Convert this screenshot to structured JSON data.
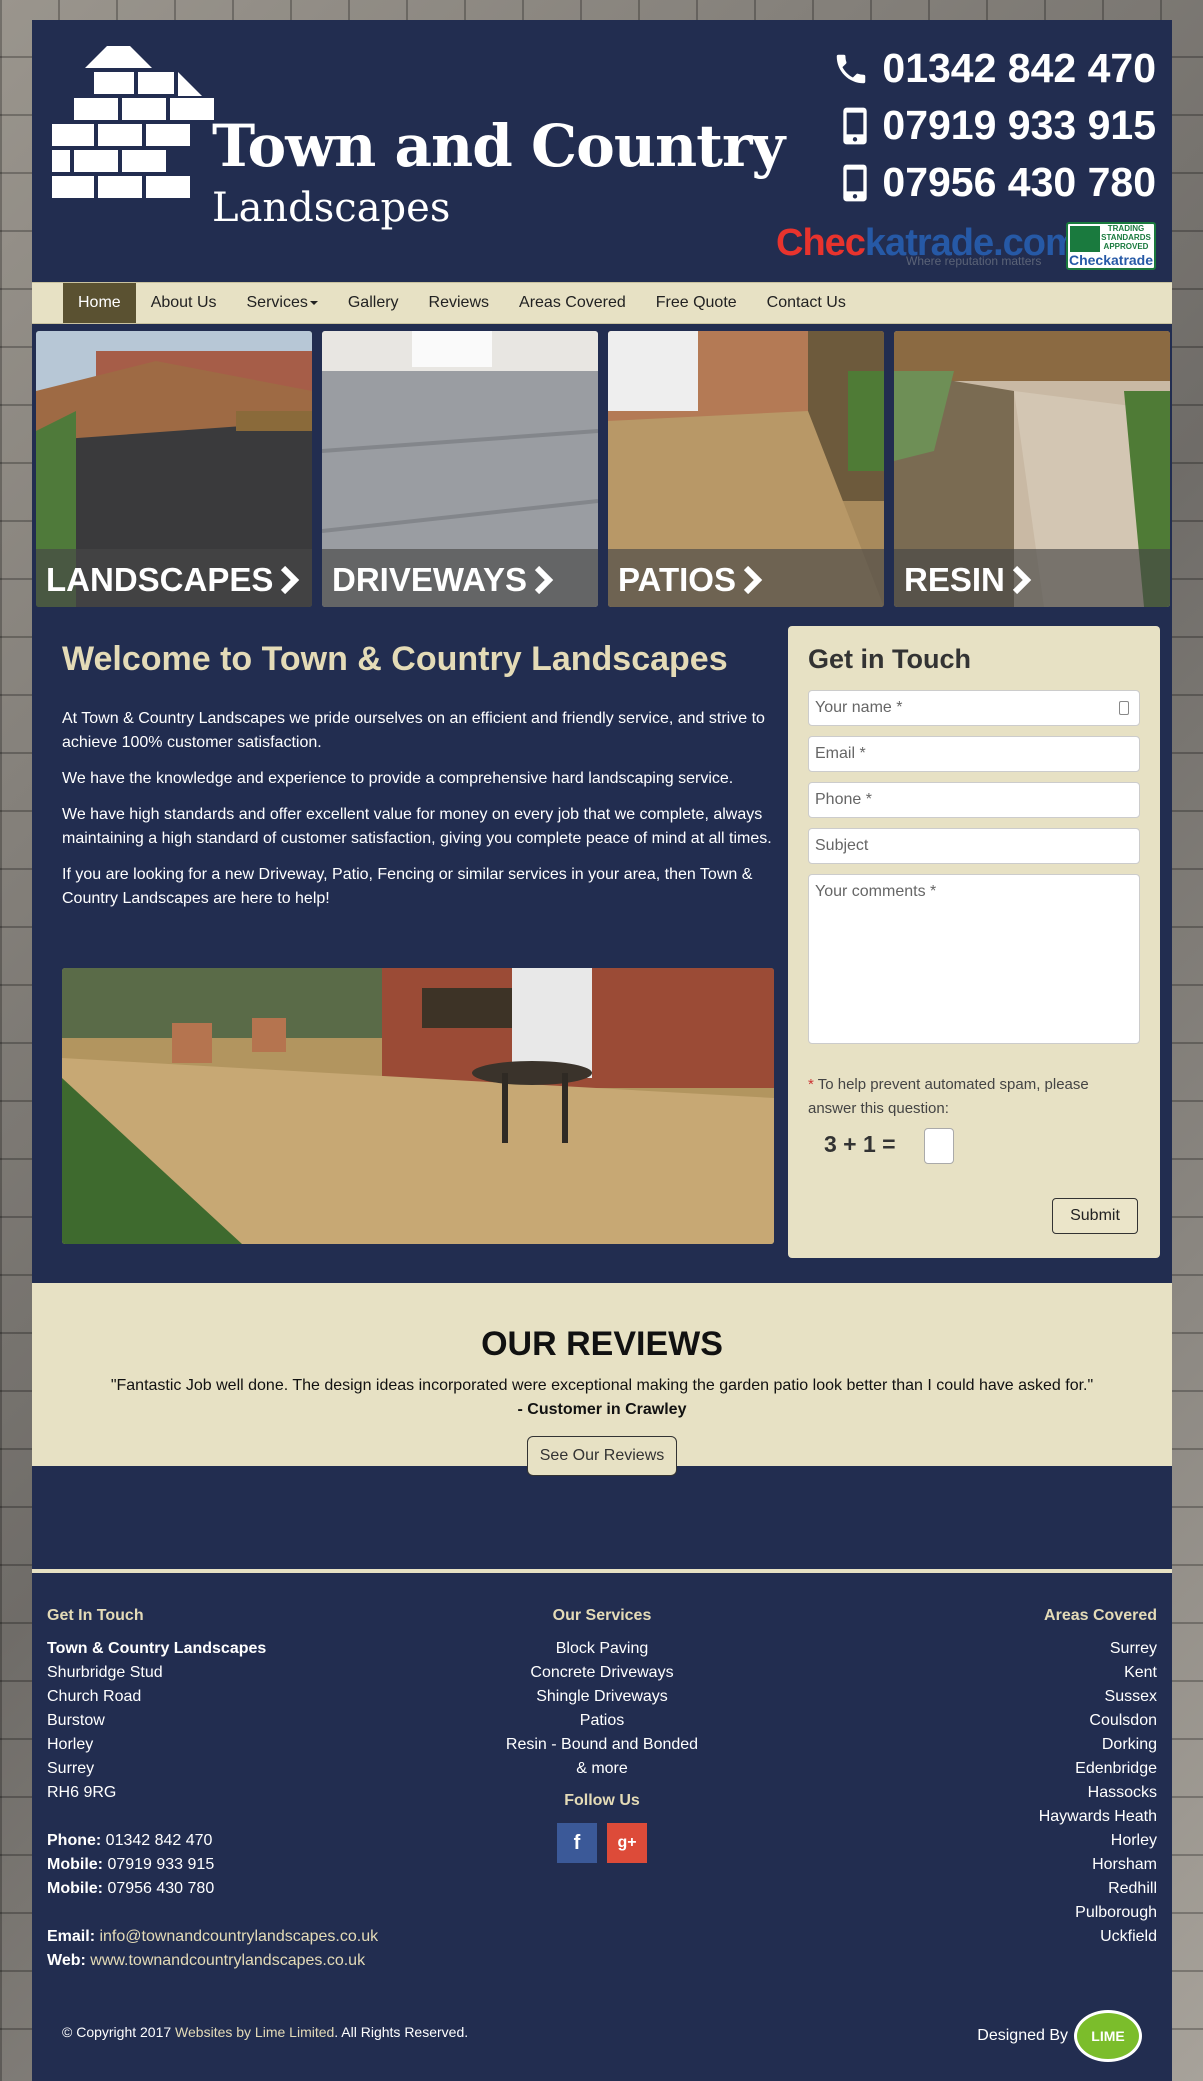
{
  "header": {
    "logo_title": "Town and Country",
    "logo_subtitle": "Landscapes",
    "phones": [
      "01342 842 470",
      "07919 933 915",
      "07956 430 780"
    ],
    "checkatrade_a": "Chec",
    "checkatrade_b": "katrade.com",
    "checkatrade_tag": "Where reputation matters",
    "badge_text": "TRADING STANDARDS APPROVED",
    "badge_brand": "Checkatrade"
  },
  "nav": {
    "items": [
      "Home",
      "About Us",
      "Services",
      "Gallery",
      "Reviews",
      "Areas Covered",
      "Free Quote",
      "Contact Us"
    ]
  },
  "tiles": [
    "LANDSCAPES",
    "DRIVEWAYS",
    "PATIOS",
    "RESIN"
  ],
  "welcome": {
    "title": "Welcome to Town & Country Landscapes",
    "paragraphs": [
      "At Town & Country Landscapes we pride ourselves on an efficient and friendly service, and strive to achieve 100% customer satisfaction.",
      "We have the knowledge and experience to provide a comprehensive hard landscaping service.",
      "We have high standards and offer excellent value for money on every job that we complete, always maintaining a high standard of customer satisfaction, giving you complete peace of mind at all times.",
      "If you are looking for a new Driveway, Patio, Fencing or similar services in your area, then Town & Country Landscapes are here to help!"
    ]
  },
  "form": {
    "title": "Get in Touch",
    "name_placeholder": "Your name *",
    "email_placeholder": "Email *",
    "phone_placeholder": "Phone *",
    "subject_placeholder": "Subject",
    "comments_placeholder": "Your comments *",
    "spam_star": "*",
    "spam_text": " To help prevent automated spam, please answer this question:",
    "captcha": "3 + 1 =",
    "submit": "Submit"
  },
  "reviews": {
    "title": "OUR REVIEWS",
    "quote": "\"Fantastic Job well done. The design ideas incorporated were exceptional making the garden patio look better than I could have asked for.\"",
    "customer": "- Customer in Crawley",
    "button": "See Our Reviews"
  },
  "footer": {
    "touch_title": "Get In Touch",
    "company": "Town & Country Landscapes",
    "address": [
      "Shurbridge Stud",
      "Church Road",
      "Burstow",
      "Horley",
      "Surrey",
      "RH6 9RG"
    ],
    "phone_label": "Phone:",
    "phone": " 01342 842 470",
    "mobile_label": "Mobile:",
    "mobile1": " 07919 933 915",
    "mobile2": " 07956 430 780",
    "email_label": "Email:",
    "email": " info@townandcountrylandscapes.co.uk",
    "web_label": "Web:",
    "web": " www.townandcountrylandscapes.co.uk",
    "services_title": "Our Services",
    "services": [
      "Block Paving",
      "Concrete Driveways",
      "Shingle Driveways",
      "Patios",
      "Resin - Bound and Bonded",
      "& more"
    ],
    "follow_title": "Follow Us",
    "facebook": "f",
    "google": "g+",
    "areas_title": "Areas Covered",
    "areas": [
      "Surrey",
      "Kent",
      "Sussex",
      "Coulsdon",
      "Dorking",
      "Edenbridge",
      "Hassocks",
      "Haywards Heath",
      "Horley",
      "Horsham",
      "Redhill",
      "Pulborough",
      "Uckfield"
    ],
    "copy_a": "© Copyright 2017 ",
    "copy_link": "Websites by Lime Limited",
    "copy_b": ". All Rights Reserved.",
    "designed_by": "Designed By",
    "lime": "LIME"
  }
}
